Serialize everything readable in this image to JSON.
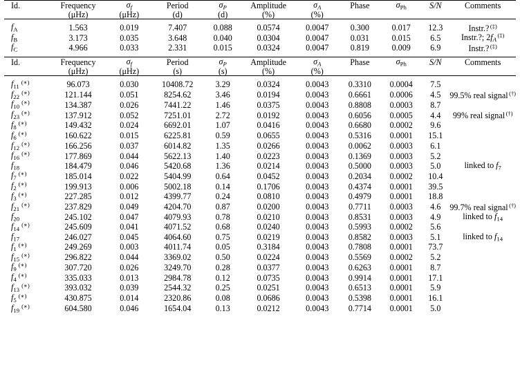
{
  "table": {
    "header_a": {
      "line1": [
        "Id.",
        "Frequency",
        "σ",
        "Period",
        "σ",
        "Amplitude",
        "σ",
        "Phase",
        "σ",
        "S/N",
        "Comments"
      ],
      "labels": {
        "id": "Id.",
        "frequency": "Frequency",
        "sigma_f": "σ",
        "sigma_f_sub": "f",
        "period": "Period",
        "sigma_P": "σ",
        "sigma_P_sub": "P",
        "amplitude": "Amplitude",
        "sigma_A": "σ",
        "sigma_A_sub": "A",
        "phase": "Phase",
        "sigma_Ph": "σ",
        "sigma_Ph_sub": "Ph",
        "sn": "S/N",
        "comments": "Comments"
      },
      "units": {
        "frequency": "(μHz)",
        "sigma_f": "(μHz)",
        "period": "(d)",
        "sigma_P": "(d)",
        "amplitude": "(%)",
        "sigma_A": "(%)"
      }
    },
    "header_b": {
      "units": {
        "frequency": "(μHz)",
        "sigma_f": "(μHz)",
        "period": "(s)",
        "sigma_P": "(s)",
        "amplitude": "(%)",
        "sigma_A": "(%)"
      }
    },
    "footnote_markers": {
      "dagger": "(†)",
      "ddagger": "(‡)",
      "asterisk": "(∗)"
    },
    "section_a_rows": [
      {
        "id_base": "f",
        "id_sub": "A",
        "star": false,
        "frequency": "1.563",
        "sigma_f": "0.019",
        "period": "7.407",
        "sigma_P": "0.088",
        "amplitude": "0.0574",
        "sigma_A": "0.0047",
        "phase": "0.300",
        "sigma_Ph": "0.017",
        "sn": "12.3",
        "comment": "Instr.?",
        "comment_sup": "(‡)",
        "comment_extra": ""
      },
      {
        "id_base": "f",
        "id_sub": "B",
        "star": false,
        "frequency": "3.173",
        "sigma_f": "0.035",
        "period": "3.648",
        "sigma_P": "0.040",
        "amplitude": "0.0304",
        "sigma_A": "0.0047",
        "phase": "0.031",
        "sigma_Ph": "0.015",
        "sn": "6.5",
        "comment": "Instr.?; 2f",
        "comment_sub": "A",
        "comment_sup": "(‡)",
        "comment_extra": ""
      },
      {
        "id_base": "f",
        "id_sub": "C",
        "star": false,
        "frequency": "4.966",
        "sigma_f": "0.033",
        "period": "2.331",
        "sigma_P": "0.015",
        "amplitude": "0.0324",
        "sigma_A": "0.0047",
        "phase": "0.819",
        "sigma_Ph": "0.009",
        "sn": "6.9",
        "comment": "Instr.?",
        "comment_sup": "(‡)",
        "comment_extra": ""
      }
    ],
    "section_b_rows": [
      {
        "id_base": "f",
        "id_sub": "11",
        "star": true,
        "frequency": "96.073",
        "sigma_f": "0.030",
        "period": "10408.72",
        "sigma_P": "3.29",
        "amplitude": "0.0324",
        "sigma_A": "0.0043",
        "phase": "0.3310",
        "sigma_Ph": "0.0004",
        "sn": "7.5",
        "comment": "",
        "comment_sup": ""
      },
      {
        "id_base": "f",
        "id_sub": "22",
        "star": true,
        "frequency": "121.144",
        "sigma_f": "0.051",
        "period": "8254.62",
        "sigma_P": "3.46",
        "amplitude": "0.0194",
        "sigma_A": "0.0043",
        "phase": "0.6661",
        "sigma_Ph": "0.0006",
        "sn": "4.5",
        "comment": "99.5% real signal",
        "comment_sup": "(†)"
      },
      {
        "id_base": "f",
        "id_sub": "10",
        "star": true,
        "frequency": "134.387",
        "sigma_f": "0.026",
        "period": "7441.22",
        "sigma_P": "1.46",
        "amplitude": "0.0375",
        "sigma_A": "0.0043",
        "phase": "0.8808",
        "sigma_Ph": "0.0003",
        "sn": "8.7",
        "comment": "",
        "comment_sup": ""
      },
      {
        "id_base": "f",
        "id_sub": "23",
        "star": true,
        "frequency": "137.912",
        "sigma_f": "0.052",
        "period": "7251.01",
        "sigma_P": "2.72",
        "amplitude": "0.0192",
        "sigma_A": "0.0043",
        "phase": "0.6056",
        "sigma_Ph": "0.0005",
        "sn": "4.4",
        "comment": "99% real signal",
        "comment_sup": "(†)"
      },
      {
        "id_base": "f",
        "id_sub": "8",
        "star": true,
        "frequency": "149.432",
        "sigma_f": "0.024",
        "period": "6692.01",
        "sigma_P": "1.07",
        "amplitude": "0.0416",
        "sigma_A": "0.0043",
        "phase": "0.6680",
        "sigma_Ph": "0.0002",
        "sn": "9.6",
        "comment": "",
        "comment_sup": ""
      },
      {
        "id_base": "f",
        "id_sub": "6",
        "star": true,
        "frequency": "160.622",
        "sigma_f": "0.015",
        "period": "6225.81",
        "sigma_P": "0.59",
        "amplitude": "0.0655",
        "sigma_A": "0.0043",
        "phase": "0.5316",
        "sigma_Ph": "0.0001",
        "sn": "15.1",
        "comment": "",
        "comment_sup": ""
      },
      {
        "id_base": "f",
        "id_sub": "12",
        "star": true,
        "frequency": "166.256",
        "sigma_f": "0.037",
        "period": "6014.82",
        "sigma_P": "1.35",
        "amplitude": "0.0266",
        "sigma_A": "0.0043",
        "phase": "0.0062",
        "sigma_Ph": "0.0003",
        "sn": "6.1",
        "comment": "",
        "comment_sup": ""
      },
      {
        "id_base": "f",
        "id_sub": "16",
        "star": true,
        "frequency": "177.869",
        "sigma_f": "0.044",
        "period": "5622.13",
        "sigma_P": "1.40",
        "amplitude": "0.0223",
        "sigma_A": "0.0043",
        "phase": "0.1369",
        "sigma_Ph": "0.0003",
        "sn": "5.2",
        "comment": "",
        "comment_sup": ""
      },
      {
        "id_base": "f",
        "id_sub": "18",
        "star": false,
        "frequency": "184.479",
        "sigma_f": "0.046",
        "period": "5420.68",
        "sigma_P": "1.36",
        "amplitude": "0.0214",
        "sigma_A": "0.0043",
        "phase": "0.5000",
        "sigma_Ph": "0.0003",
        "sn": "5.0",
        "comment": "linked to f",
        "comment_link_sub": "7",
        "comment_sup": ""
      },
      {
        "id_base": "f",
        "id_sub": "7",
        "star": true,
        "frequency": "185.014",
        "sigma_f": "0.022",
        "period": "5404.99",
        "sigma_P": "0.64",
        "amplitude": "0.0452",
        "sigma_A": "0.0043",
        "phase": "0.2034",
        "sigma_Ph": "0.0002",
        "sn": "10.4",
        "comment": "",
        "comment_sup": ""
      },
      {
        "id_base": "f",
        "id_sub": "2",
        "star": true,
        "frequency": "199.913",
        "sigma_f": "0.006",
        "period": "5002.18",
        "sigma_P": "0.14",
        "amplitude": "0.1706",
        "sigma_A": "0.0043",
        "phase": "0.4374",
        "sigma_Ph": "0.0001",
        "sn": "39.5",
        "comment": "",
        "comment_sup": ""
      },
      {
        "id_base": "f",
        "id_sub": "3",
        "star": true,
        "frequency": "227.285",
        "sigma_f": "0.012",
        "period": "4399.77",
        "sigma_P": "0.24",
        "amplitude": "0.0810",
        "sigma_A": "0.0043",
        "phase": "0.4979",
        "sigma_Ph": "0.0001",
        "sn": "18.8",
        "comment": "",
        "comment_sup": ""
      },
      {
        "id_base": "f",
        "id_sub": "21",
        "star": true,
        "frequency": "237.829",
        "sigma_f": "0.049",
        "period": "4204.70",
        "sigma_P": "0.87",
        "amplitude": "0.0200",
        "sigma_A": "0.0043",
        "phase": "0.7711",
        "sigma_Ph": "0.0003",
        "sn": "4.6",
        "comment": "99.7% real signal",
        "comment_sup": "(†)"
      },
      {
        "id_base": "f",
        "id_sub": "20",
        "star": false,
        "frequency": "245.102",
        "sigma_f": "0.047",
        "period": "4079.93",
        "sigma_P": "0.78",
        "amplitude": "0.0210",
        "sigma_A": "0.0043",
        "phase": "0.8531",
        "sigma_Ph": "0.0003",
        "sn": "4.9",
        "comment": "linked to f",
        "comment_link_sub": "14",
        "comment_sup": ""
      },
      {
        "id_base": "f",
        "id_sub": "14",
        "star": true,
        "frequency": "245.609",
        "sigma_f": "0.041",
        "period": "4071.52",
        "sigma_P": "0.68",
        "amplitude": "0.0240",
        "sigma_A": "0.0043",
        "phase": "0.5993",
        "sigma_Ph": "0.0002",
        "sn": "5.6",
        "comment": "",
        "comment_sup": ""
      },
      {
        "id_base": "f",
        "id_sub": "17",
        "star": false,
        "frequency": "246.027",
        "sigma_f": "0.045",
        "period": "4064.60",
        "sigma_P": "0.75",
        "amplitude": "0.0219",
        "sigma_A": "0.0043",
        "phase": "0.8582",
        "sigma_Ph": "0.0003",
        "sn": "5.1",
        "comment": "linked to f",
        "comment_link_sub": "14",
        "comment_sup": ""
      },
      {
        "id_base": "f",
        "id_sub": "1",
        "star": true,
        "frequency": "249.269",
        "sigma_f": "0.003",
        "period": "4011.74",
        "sigma_P": "0.05",
        "amplitude": "0.3184",
        "sigma_A": "0.0043",
        "phase": "0.7808",
        "sigma_Ph": "0.0001",
        "sn": "73.7",
        "comment": "",
        "comment_sup": ""
      },
      {
        "id_base": "f",
        "id_sub": "15",
        "star": true,
        "frequency": "296.822",
        "sigma_f": "0.044",
        "period": "3369.02",
        "sigma_P": "0.50",
        "amplitude": "0.0224",
        "sigma_A": "0.0043",
        "phase": "0.5569",
        "sigma_Ph": "0.0002",
        "sn": "5.2",
        "comment": "",
        "comment_sup": ""
      },
      {
        "id_base": "f",
        "id_sub": "9",
        "star": true,
        "frequency": "307.720",
        "sigma_f": "0.026",
        "period": "3249.70",
        "sigma_P": "0.28",
        "amplitude": "0.0377",
        "sigma_A": "0.0043",
        "phase": "0.6263",
        "sigma_Ph": "0.0001",
        "sn": "8.7",
        "comment": "",
        "comment_sup": ""
      },
      {
        "id_base": "f",
        "id_sub": "4",
        "star": true,
        "frequency": "335.033",
        "sigma_f": "0.013",
        "period": "2984.78",
        "sigma_P": "0.12",
        "amplitude": "0.0735",
        "sigma_A": "0.0043",
        "phase": "0.9914",
        "sigma_Ph": "0.0001",
        "sn": "17.1",
        "comment": "",
        "comment_sup": ""
      },
      {
        "id_base": "f",
        "id_sub": "13",
        "star": true,
        "frequency": "393.032",
        "sigma_f": "0.039",
        "period": "2544.32",
        "sigma_P": "0.25",
        "amplitude": "0.0251",
        "sigma_A": "0.0043",
        "phase": "0.6513",
        "sigma_Ph": "0.0001",
        "sn": "5.9",
        "comment": "",
        "comment_sup": ""
      },
      {
        "id_base": "f",
        "id_sub": "5",
        "star": true,
        "frequency": "430.875",
        "sigma_f": "0.014",
        "period": "2320.86",
        "sigma_P": "0.08",
        "amplitude": "0.0686",
        "sigma_A": "0.0043",
        "phase": "0.5398",
        "sigma_Ph": "0.0001",
        "sn": "16.1",
        "comment": "",
        "comment_sup": ""
      },
      {
        "id_base": "f",
        "id_sub": "19",
        "star": true,
        "frequency": "604.580",
        "sigma_f": "0.046",
        "period": "1654.04",
        "sigma_P": "0.13",
        "amplitude": "0.0212",
        "sigma_A": "0.0043",
        "phase": "0.7714",
        "sigma_Ph": "0.0001",
        "sn": "5.0",
        "comment": "",
        "comment_sup": ""
      }
    ]
  }
}
